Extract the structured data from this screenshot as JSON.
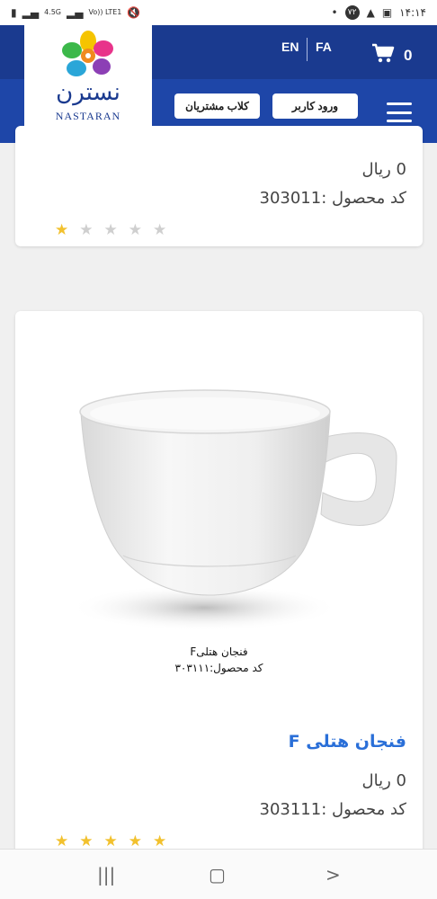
{
  "status_bar": {
    "left_icons": [
      "battery-icon",
      "signal-icon",
      "signal-icon",
      "mute-icon"
    ],
    "network_label": "4.5G",
    "volte_label": "Vo)) LTE1",
    "right_icons": [
      "notification-dot-icon",
      "badge-icon",
      "warning-icon",
      "image-icon"
    ],
    "badge_text": "۷۲",
    "time": "۱۴:۱۴"
  },
  "header": {
    "lang_en": "EN",
    "lang_fa": "FA",
    "cart_count": "0",
    "login_button": "ورود کاربر",
    "club_button": "کلاب مشتریان"
  },
  "logo": {
    "name_fa": "نسترن",
    "name_en": "NASTARAN"
  },
  "products": [
    {
      "price": "0 ریال",
      "code": "کد محصول :303011",
      "rating": 1,
      "max_rating": 5
    },
    {
      "image_caption_title": "فنجان هتلیF",
      "image_caption_code": "کد محصول:۳۰۳۱۱۱",
      "title": "فنجان هتلی F",
      "price": "0 ریال",
      "code": "کد محصول :303111",
      "rating": 5,
      "max_rating": 5
    }
  ],
  "navbar": {
    "recent_icon": "recent-apps-icon",
    "home_icon": "home-icon",
    "back_icon": "back-icon"
  },
  "colors": {
    "header_top": "#1a3a8f",
    "header_bottom": "#1e46a8",
    "title_blue": "#2a6fd8",
    "star_on": "#f2c12e",
    "star_off": "#cfcfcf"
  }
}
